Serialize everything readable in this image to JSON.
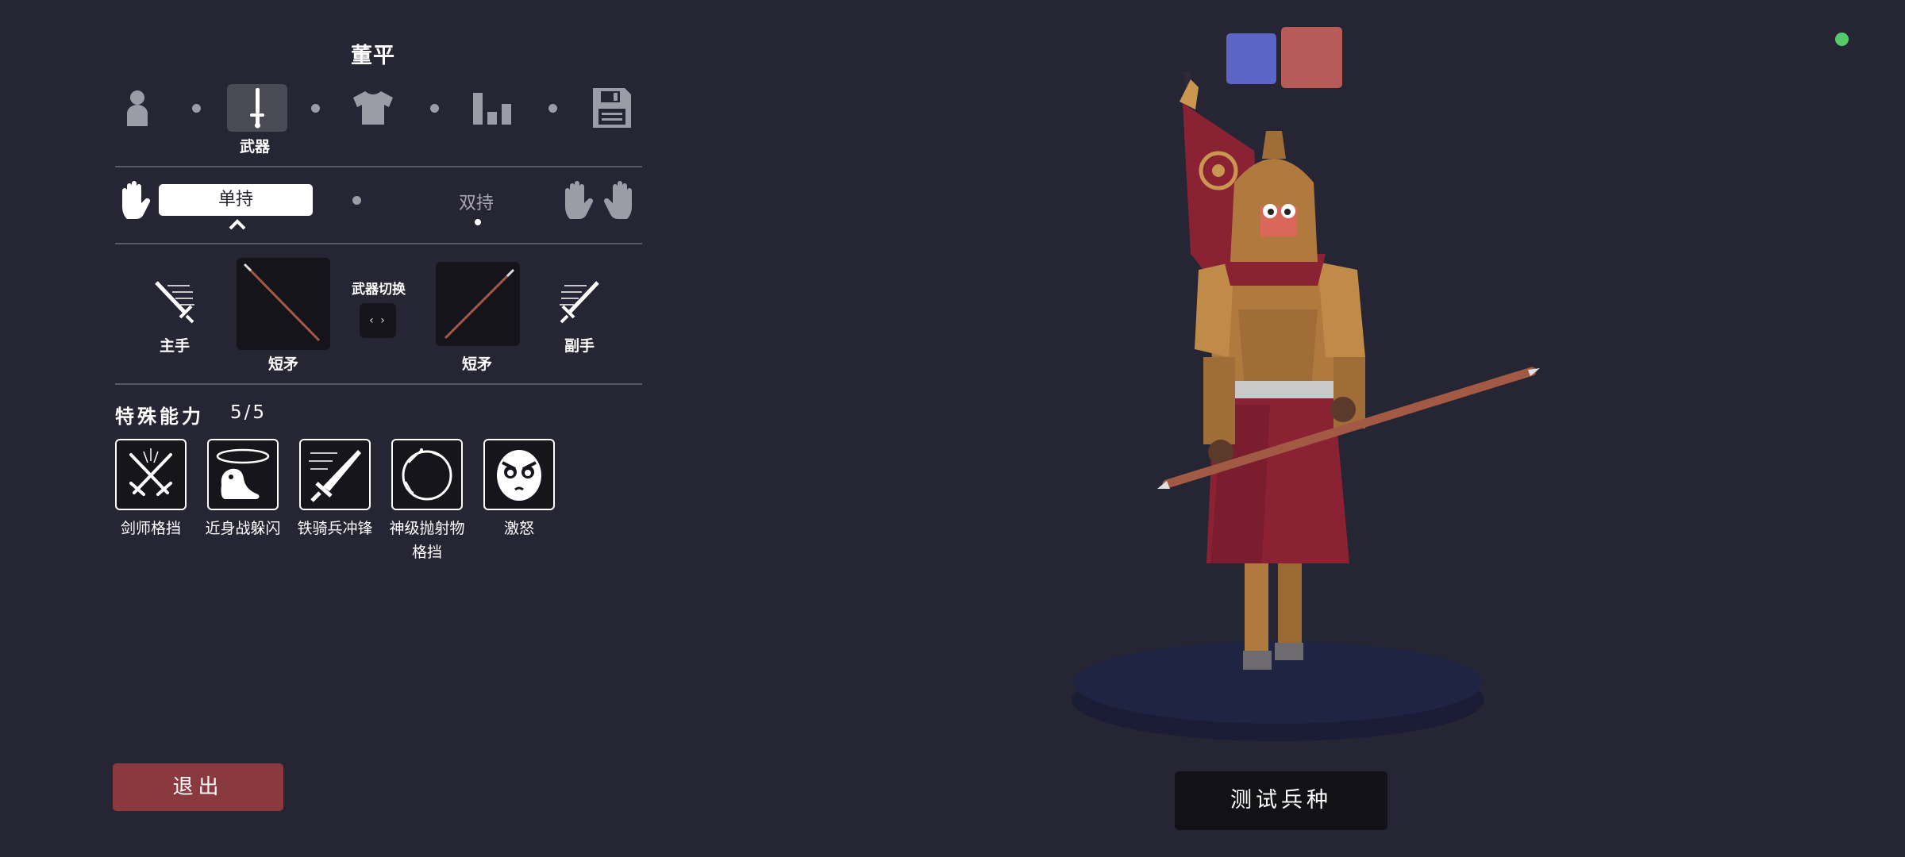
{
  "unit": {
    "name": "董平"
  },
  "categories": [
    {
      "id": "character",
      "icon": "person-icon",
      "active": false
    },
    {
      "id": "weapons",
      "icon": "sword-icon",
      "active": true,
      "label": "武器"
    },
    {
      "id": "clothing",
      "icon": "shirt-icon",
      "active": false
    },
    {
      "id": "stats",
      "icon": "bar-chart-icon",
      "active": false
    },
    {
      "id": "save",
      "icon": "floppy-disk-icon",
      "active": false
    }
  ],
  "grip": {
    "single": "单持",
    "double": "双持",
    "selected": "single"
  },
  "weapons": {
    "main_hand_label": "主手",
    "off_hand_label": "副手",
    "main_weapon": "短矛",
    "off_weapon": "短矛",
    "swap_title": "武器切换",
    "swap_symbol": "‹ ›"
  },
  "abilities": {
    "title": "特殊能力",
    "count": "5/5",
    "items": [
      {
        "name": "剑师格挡",
        "icon": "crossed-swords-icon"
      },
      {
        "name": "近身战躲闪",
        "icon": "dodge-icon"
      },
      {
        "name": "铁骑兵冲锋",
        "icon": "charging-sword-icon"
      },
      {
        "name": "神级抛射物\n格挡",
        "icon": "projectile-block-icon"
      },
      {
        "name": "激怒",
        "icon": "angry-face-icon"
      }
    ]
  },
  "actions": {
    "exit": "退出",
    "test": "测试兵种"
  },
  "teams": {
    "blue": "#5a65c6",
    "red": "#b65b58"
  },
  "status": {
    "online_color": "#56c96a"
  }
}
